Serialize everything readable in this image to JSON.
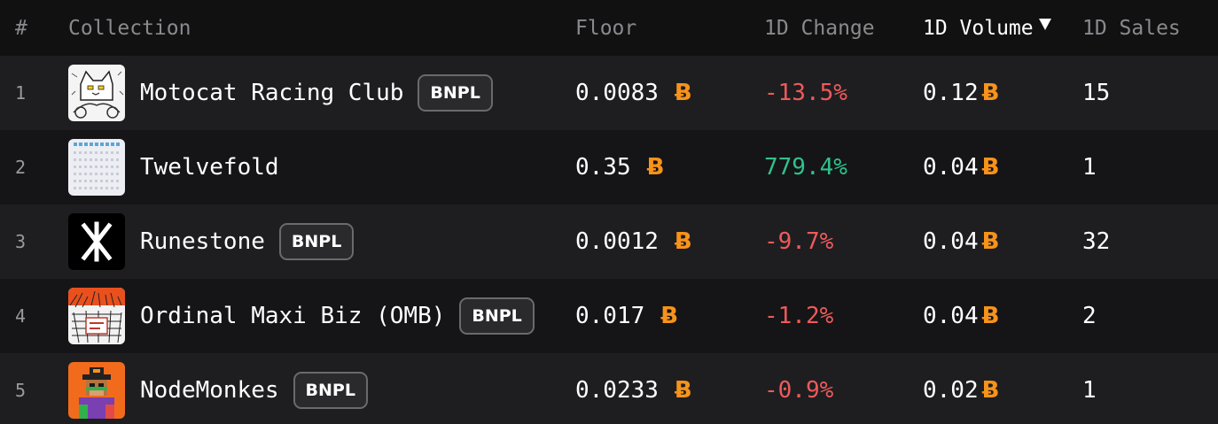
{
  "header": {
    "rank": "#",
    "collection": "Collection",
    "floor": "Floor",
    "change": "1D Change",
    "volume": "1D Volume",
    "sales": "1D Sales"
  },
  "btc_symbol": "Ƀ",
  "accent_btc": "#f7931a",
  "negative_color": "#ee5a5a",
  "positive_color": "#2fc28b",
  "rows": [
    {
      "rank": "1",
      "name": "Motocat Racing Club",
      "badge": "BNPL",
      "floor": "0.0083",
      "change": "-13.5%",
      "change_dir": "neg",
      "volume": "0.12",
      "sales": "15",
      "icon": "motocat-thumb-icon"
    },
    {
      "rank": "2",
      "name": "Twelvefold",
      "badge": "",
      "floor": "0.35",
      "change": "779.4%",
      "change_dir": "pos",
      "volume": "0.04",
      "sales": "1",
      "icon": "twelvefold-thumb-icon"
    },
    {
      "rank": "3",
      "name": "Runestone",
      "badge": "BNPL",
      "floor": "0.0012",
      "change": "-9.7%",
      "change_dir": "neg",
      "volume": "0.04",
      "sales": "32",
      "icon": "runestone-thumb-icon"
    },
    {
      "rank": "4",
      "name": "Ordinal Maxi Biz (OMB)",
      "badge": "BNPL",
      "floor": "0.017",
      "change": "-1.2%",
      "change_dir": "neg",
      "volume": "0.04",
      "sales": "2",
      "icon": "omb-thumb-icon"
    },
    {
      "rank": "5",
      "name": "NodeMonkes",
      "badge": "BNPL",
      "floor": "0.0233",
      "change": "-0.9%",
      "change_dir": "neg",
      "volume": "0.02",
      "sales": "1",
      "icon": "nodemonkes-thumb-icon"
    }
  ]
}
